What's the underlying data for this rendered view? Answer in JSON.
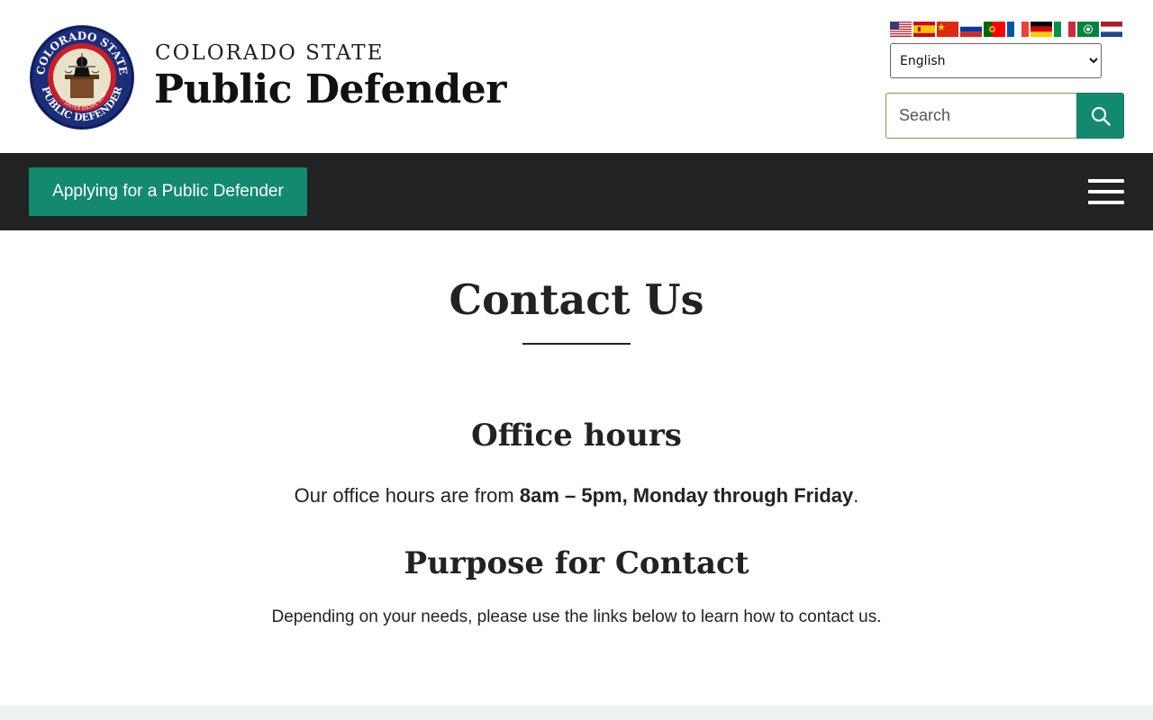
{
  "header": {
    "brand_small": "COLORADO STATE",
    "brand_big": "Public Defender",
    "seal": {
      "top_text": "COLORADO STATE",
      "bottom_text": "PUBLIC DEFENDER",
      "motto": "THAT JUSTICE ESCAPE NONE"
    }
  },
  "translate": {
    "flags": [
      "english-flag",
      "spanish-flag",
      "chinese-flag",
      "russian-flag",
      "portuguese-flag",
      "french-flag",
      "german-flag",
      "italian-flag",
      "arabic-flag",
      "dutch-flag"
    ],
    "selected_language": "English"
  },
  "search": {
    "placeholder": "Search",
    "value": "",
    "icon": "search-icon"
  },
  "nav": {
    "apply_label": "Applying for a Public Defender",
    "menu_icon": "hamburger-menu-icon"
  },
  "main": {
    "title": "Contact Us",
    "office_hours_heading": "Office hours",
    "office_hours_prefix": "Our office hours are from ",
    "office_hours_bold": "8am – 5pm, Monday through Friday",
    "office_hours_suffix": ".",
    "purpose_heading": "Purpose for Contact",
    "purpose_text": "Depending on your needs, please use the links below to learn how to contact us."
  },
  "colors": {
    "accent_green": "#138a6f",
    "navbar_dark": "#212322",
    "text_dark": "#222222"
  }
}
